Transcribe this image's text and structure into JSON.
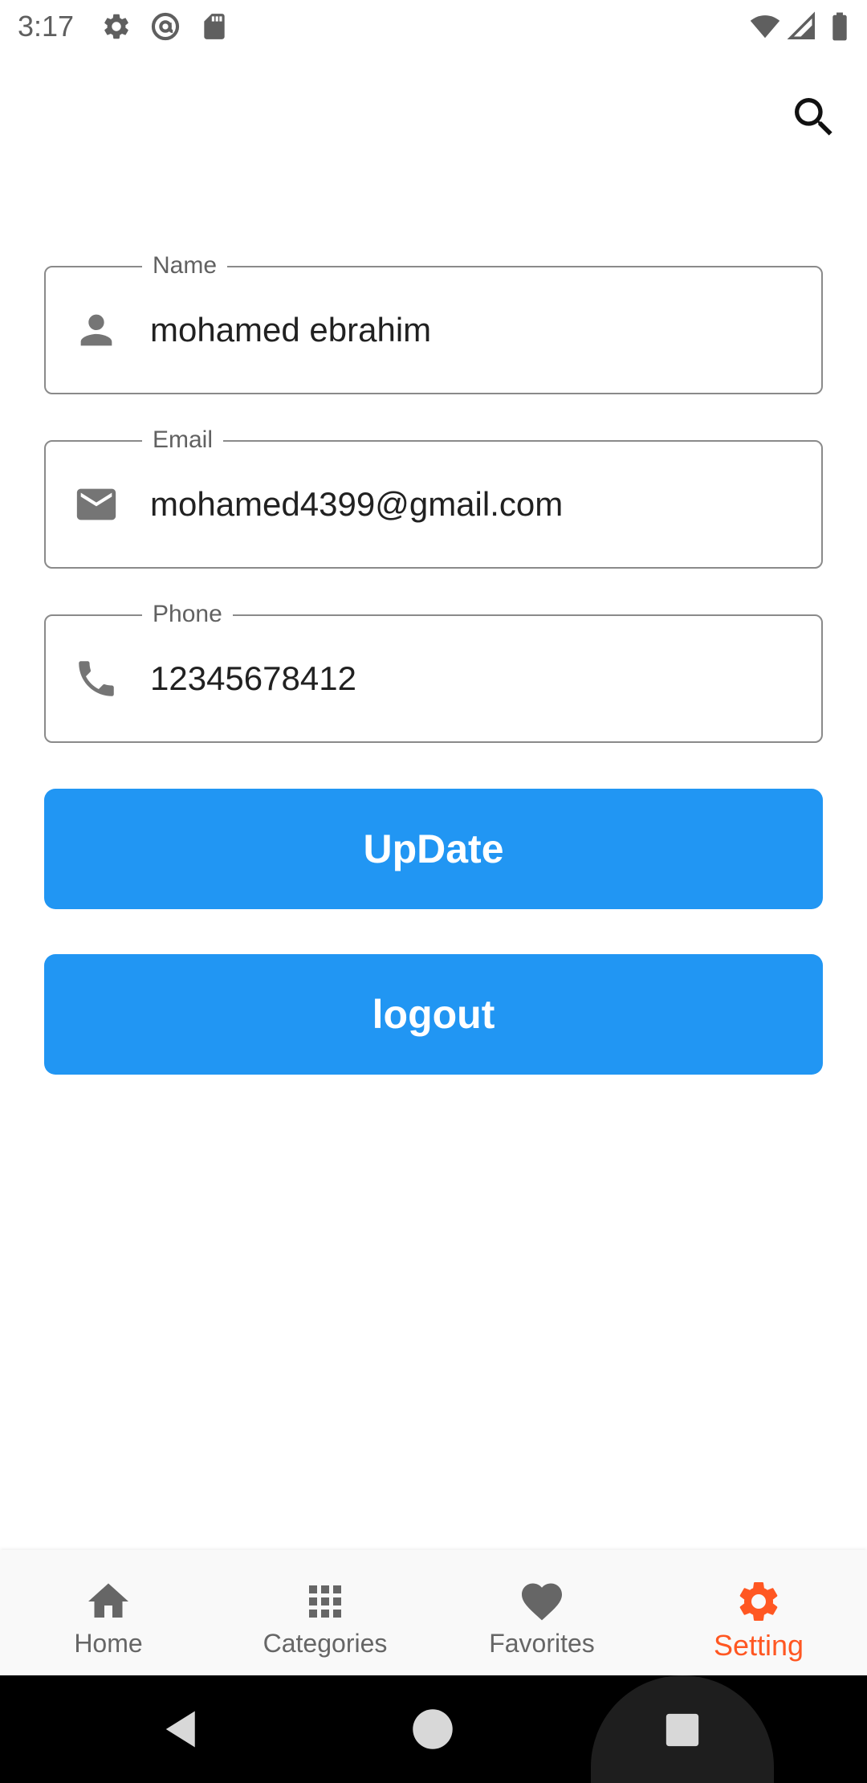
{
  "status_bar": {
    "time": "3:17",
    "left_icons": [
      "settings-icon",
      "at-sign-icon",
      "sd-card-icon"
    ],
    "right_icons": [
      "wifi-icon",
      "cellular-signal-icon",
      "battery-icon"
    ]
  },
  "app_bar": {
    "action_icon": "search-icon"
  },
  "form": {
    "name": {
      "label": "Name",
      "value": "mohamed ebrahim",
      "icon": "person-icon"
    },
    "email": {
      "label": "Email",
      "value": "mohamed4399@gmail.com",
      "icon": "mail-icon"
    },
    "phone": {
      "label": "Phone",
      "value": "12345678412",
      "icon": "phone-icon"
    }
  },
  "buttons": {
    "update": "UpDate",
    "logout": "logout"
  },
  "bottom_nav": {
    "items": [
      {
        "label": "Home",
        "icon": "home-icon"
      },
      {
        "label": "Categories",
        "icon": "grid-icon"
      },
      {
        "label": "Favorites",
        "icon": "heart-icon"
      },
      {
        "label": "Setting",
        "icon": "settings-icon"
      }
    ],
    "active_index": 3
  },
  "colors": {
    "primary": "#2196F3",
    "accent": "#FF5722",
    "inactive": "#666666",
    "field_border": "#8a8a8a"
  }
}
